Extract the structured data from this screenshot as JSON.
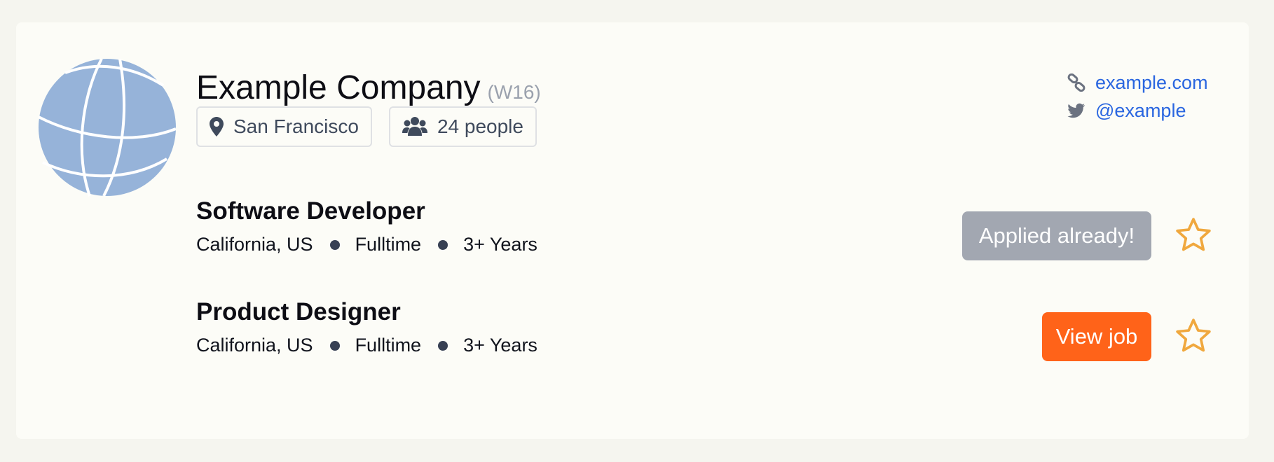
{
  "company": {
    "name": "Example Company",
    "batch": "(W16)",
    "location": "San Francisco",
    "team_size": "24 people",
    "website": "example.com",
    "twitter": "@example"
  },
  "jobs": [
    {
      "title": "Software Developer",
      "location": "California, US",
      "type": "Fulltime",
      "experience": "3+ Years",
      "action_label": "Applied already!",
      "action_state": "applied"
    },
    {
      "title": "Product Designer",
      "location": "California, US",
      "type": "Fulltime",
      "experience": "3+ Years",
      "action_label": "View job",
      "action_state": "open"
    }
  ],
  "icons": {
    "logo": "globe-icon",
    "location": "map-pin-icon",
    "team": "users-icon",
    "website": "link-icon",
    "twitter": "twitter-icon",
    "favorite": "star-outline-icon"
  },
  "colors": {
    "accent": "#ff6319",
    "link": "#2a66e0",
    "disabled_button": "#a2a7b1",
    "star": "#f0a83e",
    "logo": "#96b3d9"
  }
}
